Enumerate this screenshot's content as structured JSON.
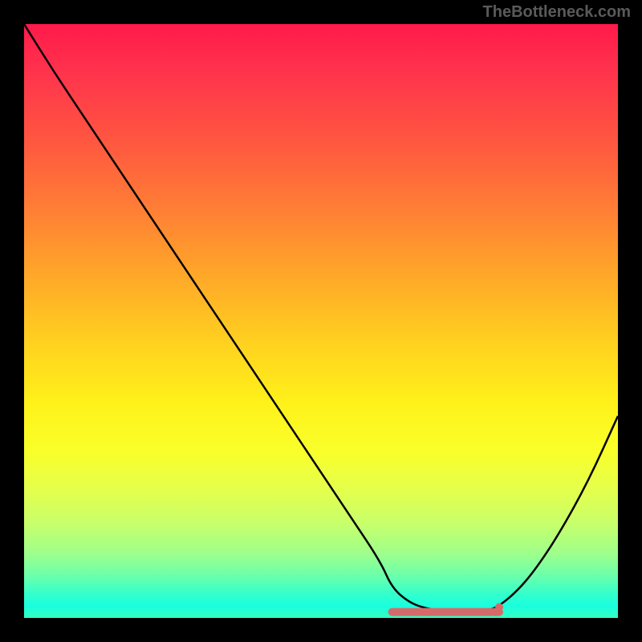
{
  "watermark": "TheBottleneck.com",
  "chart_data": {
    "type": "line",
    "title": "",
    "xlabel": "",
    "ylabel": "",
    "x_range": [
      0,
      100
    ],
    "y_range": [
      0,
      100
    ],
    "series": [
      {
        "name": "bottleneck-curve",
        "x": [
          0,
          5,
          10,
          15,
          20,
          25,
          30,
          35,
          40,
          45,
          50,
          55,
          60,
          62,
          65,
          68,
          72,
          75,
          78,
          80,
          83,
          86,
          90,
          95,
          100
        ],
        "y": [
          100,
          92,
          84.5,
          77,
          69.5,
          62,
          54.5,
          47,
          39.5,
          32,
          24.5,
          17,
          9.5,
          5,
          2.5,
          1.5,
          1,
          1,
          1.2,
          2,
          4.5,
          8,
          14,
          23,
          34
        ]
      }
    ],
    "optimal_band": {
      "x_start": 62,
      "x_end": 80,
      "y": 1
    },
    "background_gradient": {
      "top": "#ff1a4a",
      "mid": "#ffe21f",
      "bottom": "#33ffc0"
    }
  }
}
